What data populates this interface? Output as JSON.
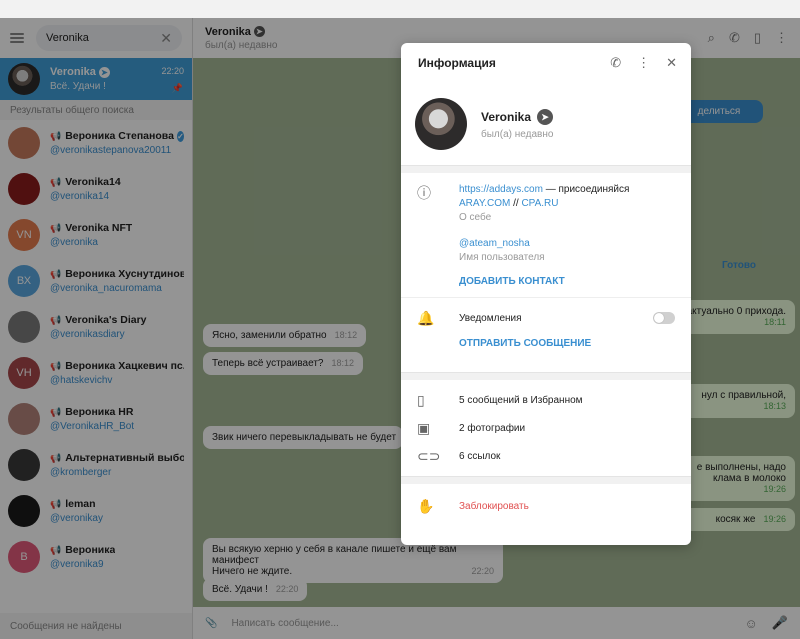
{
  "sidebar": {
    "search_value": "Veronika",
    "active_chat": {
      "name": "Veronika",
      "preview": "Всё. Удачи !",
      "time": "22:20"
    },
    "results_label": "Результаты общего поиска",
    "results": [
      {
        "name": "Вероника Степанова",
        "handle": "@veronikastepanova20011",
        "verified": true,
        "avatar_color": "#c77b5e"
      },
      {
        "name": "Veronika14",
        "handle": "@veronika14",
        "avatar_color": "#8a1c1c"
      },
      {
        "name": "Veronika NFT",
        "handle": "@veronika",
        "avatar_initials": "VN",
        "avatar_color": "#e57c4f"
      },
      {
        "name": "Вероника Хуснутдинова",
        "handle": "@veronika_nacuromama",
        "avatar_initials": "ВХ",
        "avatar_color": "#5aa7e0"
      },
      {
        "name": "Veronika's Diary",
        "handle": "@veronikasdiary",
        "avatar_color": "#7a7a7a"
      },
      {
        "name": "Вероника Хацкевич пс...",
        "handle": "@hatskevichv",
        "avatar_initials": "VH",
        "avatar_color": "#a8484a"
      },
      {
        "name": "Вероника HR",
        "handle": "@VeronikaHR_Bot",
        "avatar_color": "#b3847a"
      },
      {
        "name": "Альтернативный выбо...",
        "handle": "@kromberger",
        "avatar_color": "#3a3a3a"
      },
      {
        "name": "leman",
        "handle": "@veronikay",
        "avatar_color": "#1a1a1a"
      },
      {
        "name": "Вероника",
        "handle": "@veronika9",
        "avatar_initials": "В",
        "avatar_color": "#e25b7a"
      }
    ],
    "not_found": "Сообщения не найдены"
  },
  "chat": {
    "title": "Veronika",
    "status": "был(а) недавно",
    "background": "Готово",
    "messages": [
      {
        "text": "Ясно, заменили обратно",
        "time": "18:12"
      },
      {
        "text": "Теперь всё устраивает?",
        "time": "18:12"
      },
      {
        "text": "Звик ничего перевыкладывать не будет",
        "time": ""
      },
      {
        "text": "Вы всякую херню у себя в канале пишете и ещё вам манифест\nНичего не ждите.",
        "time": "22:20"
      },
      {
        "text": "Всё. Удачи !",
        "time": "22:20"
      }
    ],
    "right_snippets": [
      {
        "text": "делиться",
        "time": ""
      },
      {
        "text": "актуально 0 прихода.",
        "time": "18:11"
      },
      {
        "text": "нул с правильной,",
        "time": "18:13"
      },
      {
        "text": "е выполнены, надо\nклама в молоко",
        "time": "19:26"
      },
      {
        "text": "косяк же",
        "time": "19:26"
      }
    ],
    "input_placeholder": "Написать сообщение..."
  },
  "info": {
    "title": "Информация",
    "profile": {
      "name": "Veronika",
      "status": "был(а) недавно"
    },
    "bio_link": "https://addays.com",
    "bio_text": " — присоединяйся",
    "bio_link2": "ARAY.COM",
    "bio_sep": " // ",
    "bio_link3": "CPA.RU",
    "bio_caption": "О себе",
    "username": "@ateam_nosha",
    "username_caption": "Имя пользователя",
    "add_contact": "ДОБАВИТЬ КОНТАКТ",
    "notifications": "Уведомления",
    "send_message": "ОТПРАВИТЬ СООБЩЕНИЕ",
    "saved": "5 сообщений в Избранном",
    "photos": "2 фотографии",
    "links": "6 ссылок",
    "block": "Заблокировать"
  },
  "colors": {
    "accent": "#3a8fd0",
    "active_chat": "#419fd9",
    "danger": "#e05050",
    "chat_bg": "#a6b897"
  }
}
